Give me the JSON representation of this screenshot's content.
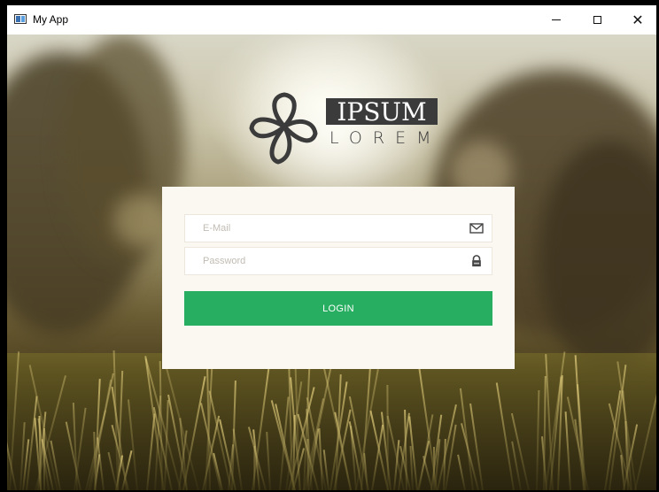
{
  "window": {
    "title": "My App",
    "minimize_icon": "minimize-icon",
    "maximize_icon": "maximize-icon",
    "close_icon": "close-icon",
    "close_glyph": "✕"
  },
  "logo": {
    "main_text": "IPSUM",
    "sub_text": "LOREM",
    "icon": "flower-logo-icon"
  },
  "login_form": {
    "email_placeholder": "E-Mail",
    "email_value": "",
    "email_icon": "envelope-icon",
    "password_placeholder": "Password",
    "password_value": "",
    "password_icon": "lock-icon",
    "login_label": "LOGIN"
  },
  "colors": {
    "accent": "#27ae60",
    "card_background": "#fbf8f2",
    "logo_dark": "#3b3b3b"
  }
}
